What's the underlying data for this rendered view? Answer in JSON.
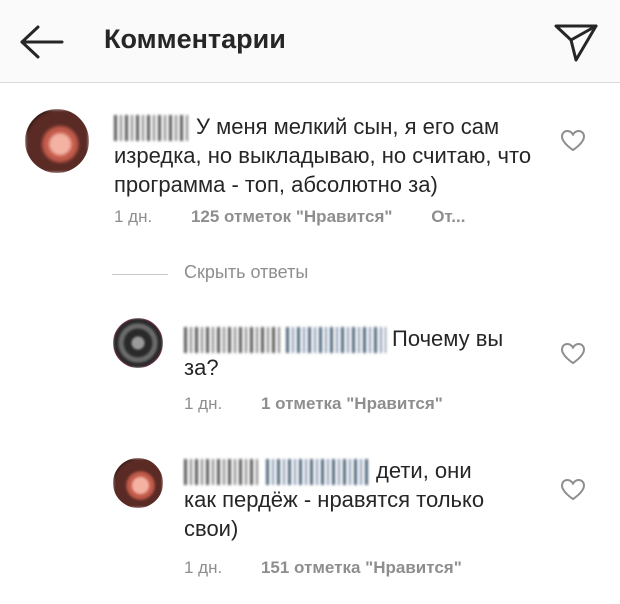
{
  "header": {
    "title": "Комментарии",
    "back_icon": "arrow-left-icon",
    "send_icon": "direct-send-icon"
  },
  "comments": [
    {
      "text": "У меня мелкий сын, я его сам изредка, но выкладываю, но считаю, что программа - топ, абсолютно за)",
      "time": "1 дн.",
      "likes": "125 отметок \"Нравится\"",
      "reply": "От..."
    }
  ],
  "hide_replies_label": "Скрыть ответы",
  "replies": [
    {
      "text": "Почему вы за?",
      "time": "1 дн.",
      "likes": "1 отметка \"Нравится\""
    },
    {
      "text": "дети, они как пердёж - нравятся только свои)",
      "time": "1 дн.",
      "likes": "151 отметка \"Нравится\""
    }
  ],
  "colors": {
    "text": "#262626",
    "muted": "#8e8e8e",
    "header_bg": "#fafafa",
    "divider": "#dbdbdb"
  }
}
